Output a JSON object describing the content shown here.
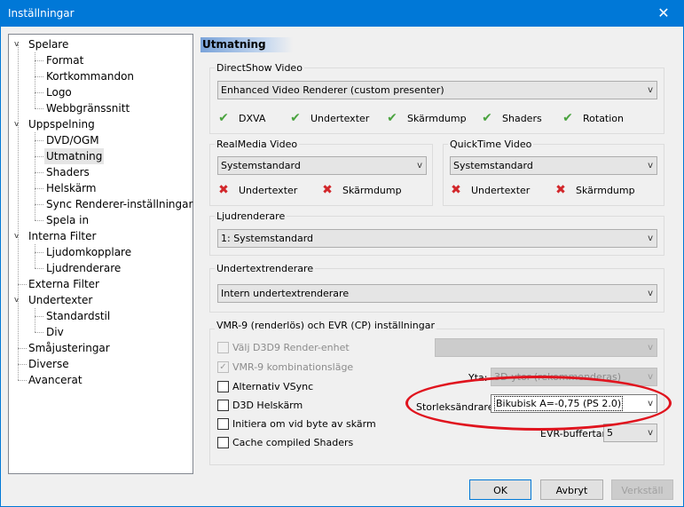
{
  "window": {
    "title": "Inställningar",
    "close_glyph": "✕"
  },
  "tree": {
    "items": [
      {
        "label": "Spelare",
        "level": 0,
        "expanded": true
      },
      {
        "label": "Format",
        "level": 1
      },
      {
        "label": "Kortkommandon",
        "level": 1
      },
      {
        "label": "Logo",
        "level": 1
      },
      {
        "label": "Webbgränssnitt",
        "level": 1
      },
      {
        "label": "Uppspelning",
        "level": 0,
        "expanded": true
      },
      {
        "label": "DVD/OGM",
        "level": 1
      },
      {
        "label": "Utmatning",
        "level": 1,
        "selected": true
      },
      {
        "label": "Shaders",
        "level": 1
      },
      {
        "label": "Helskärm",
        "level": 1
      },
      {
        "label": "Sync Renderer-inställningar",
        "level": 1
      },
      {
        "label": "Spela in",
        "level": 1
      },
      {
        "label": "Interna Filter",
        "level": 0,
        "expanded": true
      },
      {
        "label": "Ljudomkopplare",
        "level": 1
      },
      {
        "label": "Ljudrenderare",
        "level": 1
      },
      {
        "label": "Externa Filter",
        "level": 0
      },
      {
        "label": "Undertexter",
        "level": 0,
        "expanded": true
      },
      {
        "label": "Standardstil",
        "level": 1
      },
      {
        "label": "Div",
        "level": 1
      },
      {
        "label": "Småjusteringar",
        "level": 0
      },
      {
        "label": "Diverse",
        "level": 0
      },
      {
        "label": "Avancerat",
        "level": 0
      }
    ],
    "expand_glyph": "v"
  },
  "page": {
    "title": "Utmatning"
  },
  "directshow": {
    "label": "DirectShow Video",
    "renderer": "Enhanced Video Renderer (custom presenter)",
    "features": [
      "DXVA",
      "Undertexter",
      "Skärmdump",
      "Shaders",
      "Rotation"
    ]
  },
  "realmedia": {
    "label": "RealMedia Video",
    "renderer": "Systemstandard",
    "features": [
      "Undertexter",
      "Skärmdump"
    ]
  },
  "quicktime": {
    "label": "QuickTime Video",
    "renderer": "Systemstandard",
    "features": [
      "Undertexter",
      "Skärmdump"
    ]
  },
  "audio": {
    "label": "Ljudrenderare",
    "renderer": "1: Systemstandard"
  },
  "subtitle": {
    "label": "Undertextrenderare",
    "renderer": "Intern undertextrenderare"
  },
  "vmr": {
    "label": "VMR-9 (renderlös) och EVR (CP) inställningar",
    "checks": [
      {
        "label": "Välj D3D9 Render-enhet",
        "checked": false,
        "enabled": false
      },
      {
        "label": "VMR-9 kombinationsläge",
        "checked": true,
        "enabled": false
      },
      {
        "label": "Alternativ VSync",
        "checked": false,
        "enabled": true
      },
      {
        "label": "D3D Helskärm",
        "checked": false,
        "enabled": true
      },
      {
        "label": "Initiera om vid byte av skärm",
        "checked": false,
        "enabled": true
      },
      {
        "label": "Cache compiled Shaders",
        "checked": false,
        "enabled": true
      }
    ],
    "device_value": "",
    "surface_label": "Yta:",
    "surface_value": "3D-ytor (rekommenderas)",
    "resizer_label": "Storleksändrare:",
    "resizer_value": "Bikubisk A=-0,75 (PS 2.0)",
    "evr_label": "EVR-buffertar:",
    "evr_value": "5"
  },
  "glyphs": {
    "ok": "✔",
    "no": "✖",
    "check": "✓",
    "arrow": "v"
  },
  "buttons": {
    "ok": "OK",
    "cancel": "Avbryt",
    "apply": "Verkställ"
  },
  "colors": {
    "accent": "#0078d7",
    "ok": "#4aa33f",
    "no": "#d2272b",
    "annotation": "#e0141e"
  }
}
